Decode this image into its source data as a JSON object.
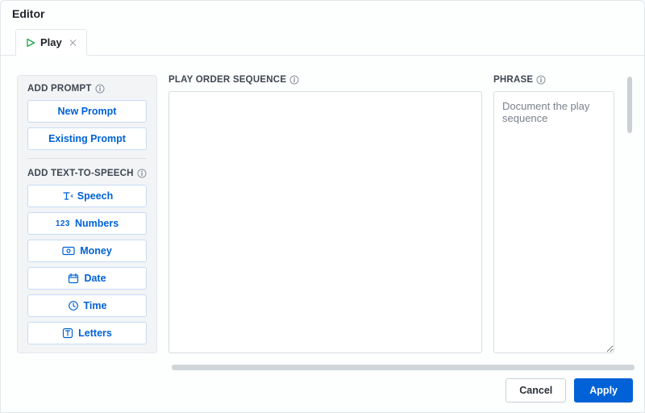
{
  "header": {
    "title": "Editor"
  },
  "tab": {
    "label": "Play"
  },
  "panel": {
    "add_prompt": {
      "title": "ADD PROMPT",
      "new": "New Prompt",
      "existing": "Existing Prompt"
    },
    "add_tts": {
      "title": "ADD TEXT-TO-SPEECH",
      "speech": "Speech",
      "numbers": "Numbers",
      "money": "Money",
      "date": "Date",
      "time": "Time",
      "letters": "Letters"
    }
  },
  "sequence": {
    "title": "PLAY ORDER SEQUENCE"
  },
  "phrase": {
    "title": "PHRASE",
    "placeholder": "Document the play sequence"
  },
  "footer": {
    "cancel": "Cancel",
    "apply": "Apply"
  }
}
